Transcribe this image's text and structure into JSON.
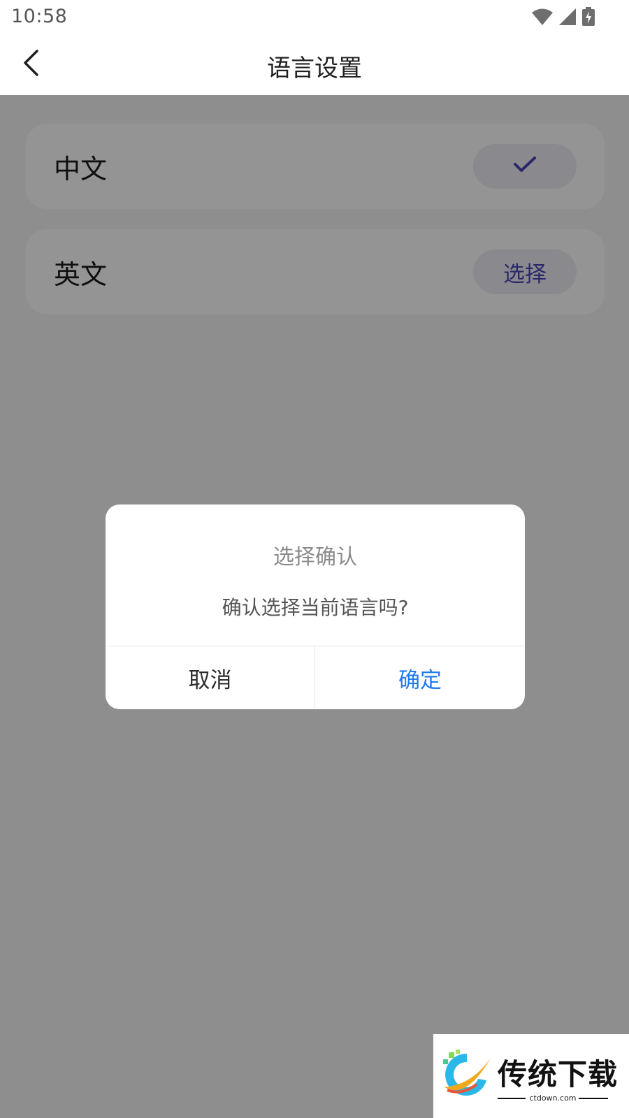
{
  "status_bar": {
    "time": "10:58",
    "icons": [
      "wifi-icon",
      "cell-signal-icon",
      "battery-charging-icon"
    ]
  },
  "header": {
    "back_icon": "chevron-left-icon",
    "title": "语言设置"
  },
  "languages": [
    {
      "label": "中文",
      "selected": true,
      "action_icon": "check-icon"
    },
    {
      "label": "英文",
      "selected": false,
      "action_label": "选择"
    }
  ],
  "dialog": {
    "title": "选择确认",
    "message": "确认选择当前语言吗?",
    "cancel_label": "取消",
    "confirm_label": "确定"
  },
  "watermark": {
    "title": "传统下载",
    "subtitle": "ctdown.com"
  },
  "colors": {
    "accent": "#4a46b5",
    "confirm": "#1d7cf2",
    "overlay": "rgba(0,0,0,0.42)"
  }
}
